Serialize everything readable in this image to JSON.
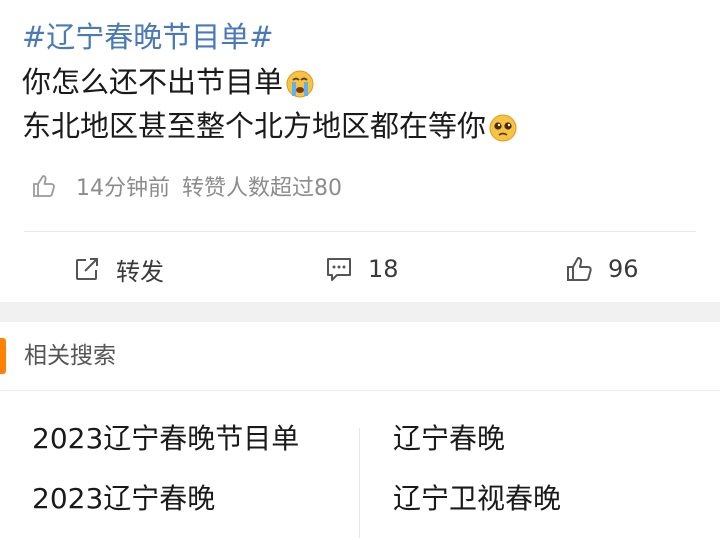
{
  "post": {
    "hashtag": "#辽宁春晚节目单#",
    "line1": "你怎么还不出节目单",
    "line2": "东北地区甚至整个北方地区都在等你",
    "emoji1": "crying-face-emoji",
    "emoji2": "pleading-face-emoji",
    "meta": {
      "time": "14分钟前",
      "likes_note": "转赞人数超过80"
    }
  },
  "actions": {
    "repost_label": "转发",
    "comment_count": "18",
    "like_count": "96"
  },
  "related": {
    "title": "相关搜索",
    "items": [
      "2023辽宁春晚节目单",
      "辽宁春晚",
      "2023辽宁春晚",
      "辽宁卫视春晚"
    ]
  },
  "colors": {
    "hashtag": "#4a79b8",
    "accent_bar": "#ff8200",
    "meta_text": "#8c8c8c",
    "section_gap": "#f1f1f1"
  }
}
